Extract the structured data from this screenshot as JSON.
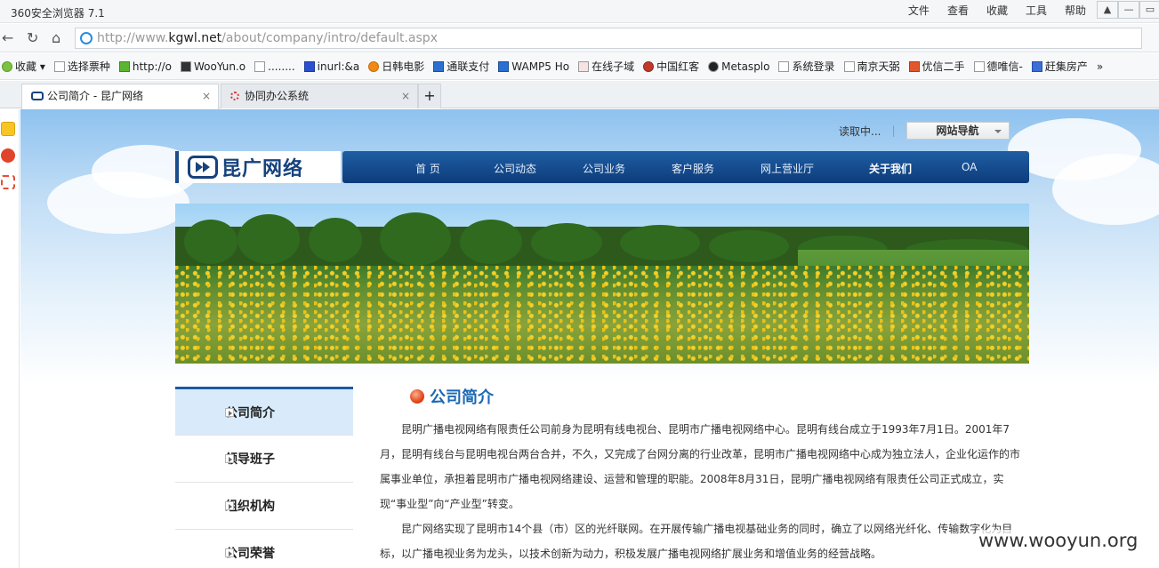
{
  "browser": {
    "title": "360安全浏览器 7.1",
    "menu": [
      "文件",
      "查看",
      "收藏",
      "工具",
      "帮助"
    ],
    "url_prefix": "http://www.",
    "url_domain": "kgwl.net",
    "url_path": "/about/company/intro/default.aspx",
    "favorites_label": "收藏",
    "favorites": [
      "选择票种",
      "http://o",
      "WooYun.o",
      "........",
      "inurl:&a",
      "日韩电影",
      "通联支付",
      "WAMP5 Ho",
      "在线子域",
      "中国红客",
      "Metasplo",
      "系统登录",
      "南京天弼",
      "优信二手",
      "德唯信-",
      "赶集房产"
    ],
    "tabs": [
      {
        "label": "公司简介 - 昆广网络"
      },
      {
        "label": "协同办公系统"
      }
    ],
    "new_tab": "+"
  },
  "site": {
    "top_status": "读取中...",
    "top_sep": "|",
    "site_nav_button": "网站导航",
    "logo_text": "昆广网络",
    "nav": [
      "首  页",
      "公司动态",
      "公司业务",
      "客户服务",
      "网上营业厅",
      "关于我们",
      "OA"
    ],
    "nav_current": "关于我们",
    "side_menu": [
      "公司简介",
      "领导班子",
      "组织机构",
      "公司荣誉"
    ],
    "section_title": "公司简介",
    "paragraphs": [
      "昆明广播电视网络有限责任公司前身为昆明有线电视台、昆明市广播电视网络中心。昆明有线台成立于1993年7月1日。2001年7月，昆明有线台与昆明电视台两台合并，不久，又完成了台网分离的行业改革，昆明市广播电视网络中心成为独立法人，企业化运作的市属事业单位，承担着昆明市广播电视网络建设、运营和管理的职能。2008年8月31日，昆明广播电视网络有限责任公司正式成立，实现“事业型”向“产业型”转变。",
      "昆广网络实现了昆明市14个县（市）区的光纤联网。在开展传输广播电视基础业务的同时，确立了以网络光纤化、传输数字化为目标，以广播电视业务为龙头，以技术创新为动力，积极发展广播电视网络扩展业务和增值业务的经营战略。"
    ]
  },
  "watermark": "www.wooyun.org",
  "colors": {
    "nav_bar": "#0d3c7a",
    "heading_blue": "#1a68b5",
    "menu_active_bg": "#d9ebfb"
  }
}
